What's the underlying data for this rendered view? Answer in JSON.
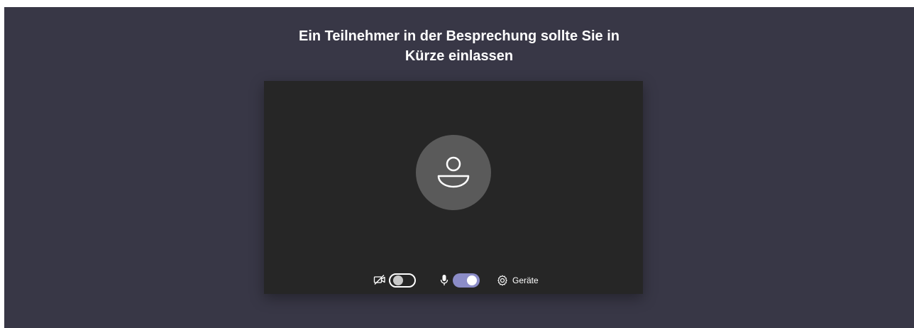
{
  "header": {
    "title_line1": "Ein Teilnehmer in der Besprechung sollte Sie in",
    "title_line2": "Kürze einlassen"
  },
  "preview": {
    "avatar_icon": "person-icon"
  },
  "controls": {
    "camera": {
      "icon": "camera-off-icon",
      "toggle_on": false
    },
    "microphone": {
      "icon": "microphone-icon",
      "toggle_on": true
    },
    "devices": {
      "icon": "gear-icon",
      "label": "Geräte"
    }
  },
  "colors": {
    "background": "#383746",
    "preview_background": "#262626",
    "avatar_circle": "#5a5a5a",
    "toggle_accent": "#8b8cc7"
  }
}
